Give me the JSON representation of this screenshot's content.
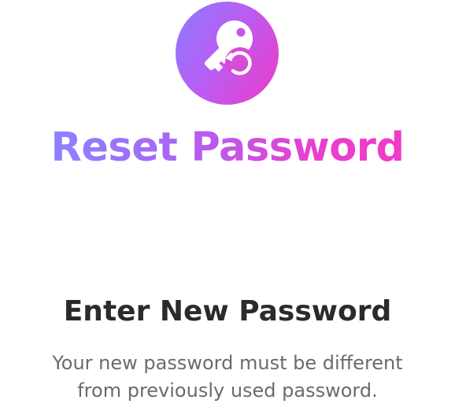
{
  "header": {
    "icon": "key-reset-icon",
    "title_part1": "Reset",
    "title_part2": "Password"
  },
  "content": {
    "heading": "Enter New Password",
    "description_line1": "Your new password must be different",
    "description_line2": "from previously used password."
  },
  "colors": {
    "gradient_start": "#8a7cff",
    "gradient_end": "#f03ac8",
    "heading": "#2b2b2b",
    "body_text": "#6b6b6b"
  }
}
